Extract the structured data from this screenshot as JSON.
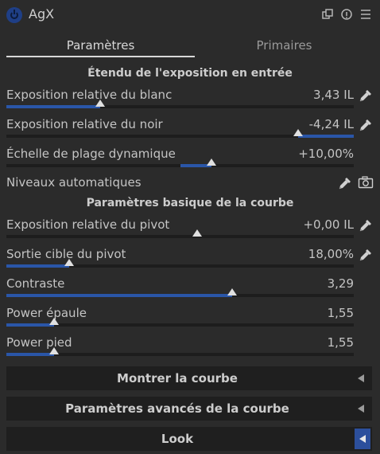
{
  "header": {
    "title": "AgX"
  },
  "tabs": [
    {
      "label": "Paramètres"
    },
    {
      "label": "Primaires"
    }
  ],
  "sections": {
    "input_exposure": "Étendu de l'exposition en entrée",
    "basic_curve": "Paramètres basique de la courbe"
  },
  "sliders": {
    "white_exposure": {
      "label": "Exposition relative du blanc",
      "value": "3,43 IL",
      "fill_from": 0.0,
      "fill_to": 0.27,
      "thumb": 0.27
    },
    "black_exposure": {
      "label": "Exposition relative du noir",
      "value": "-4,24 IL",
      "fill_from": 0.84,
      "fill_to": 1.0,
      "thumb": 0.84
    },
    "dynamic_range": {
      "label": "Échelle de plage dynamique",
      "value": "+10,00%",
      "fill_from": 0.5,
      "fill_to": 0.59,
      "thumb": 0.59
    },
    "pivot_exposure": {
      "label": "Exposition relative du pivot",
      "value": "+0,00 IL",
      "fill_from": 0.55,
      "fill_to": 0.55,
      "thumb": 0.55
    },
    "pivot_target": {
      "label": "Sortie cible du pivot",
      "value": "18,00%",
      "fill_from": 0.0,
      "fill_to": 0.18,
      "thumb": 0.18
    },
    "contrast": {
      "label": "Contraste",
      "value": "3,29",
      "fill_from": 0.0,
      "fill_to": 0.65,
      "thumb": 0.65
    },
    "shoulder_power": {
      "label": "Power épaule",
      "value": "1,55",
      "fill_from": 0.0,
      "fill_to": 0.137,
      "thumb": 0.137
    },
    "toe_power": {
      "label": "Power pied",
      "value": "1,55",
      "fill_from": 0.0,
      "fill_to": 0.137,
      "thumb": 0.137
    }
  },
  "auto_levels": {
    "label": "Niveaux automatiques"
  },
  "collapsibles": {
    "show_curve": "Montrer la courbe",
    "advanced_curve": "Paramètres avancés de la courbe",
    "look": "Look"
  },
  "colors": {
    "accent": "#2a56a8",
    "background": "#2b2b2b"
  }
}
